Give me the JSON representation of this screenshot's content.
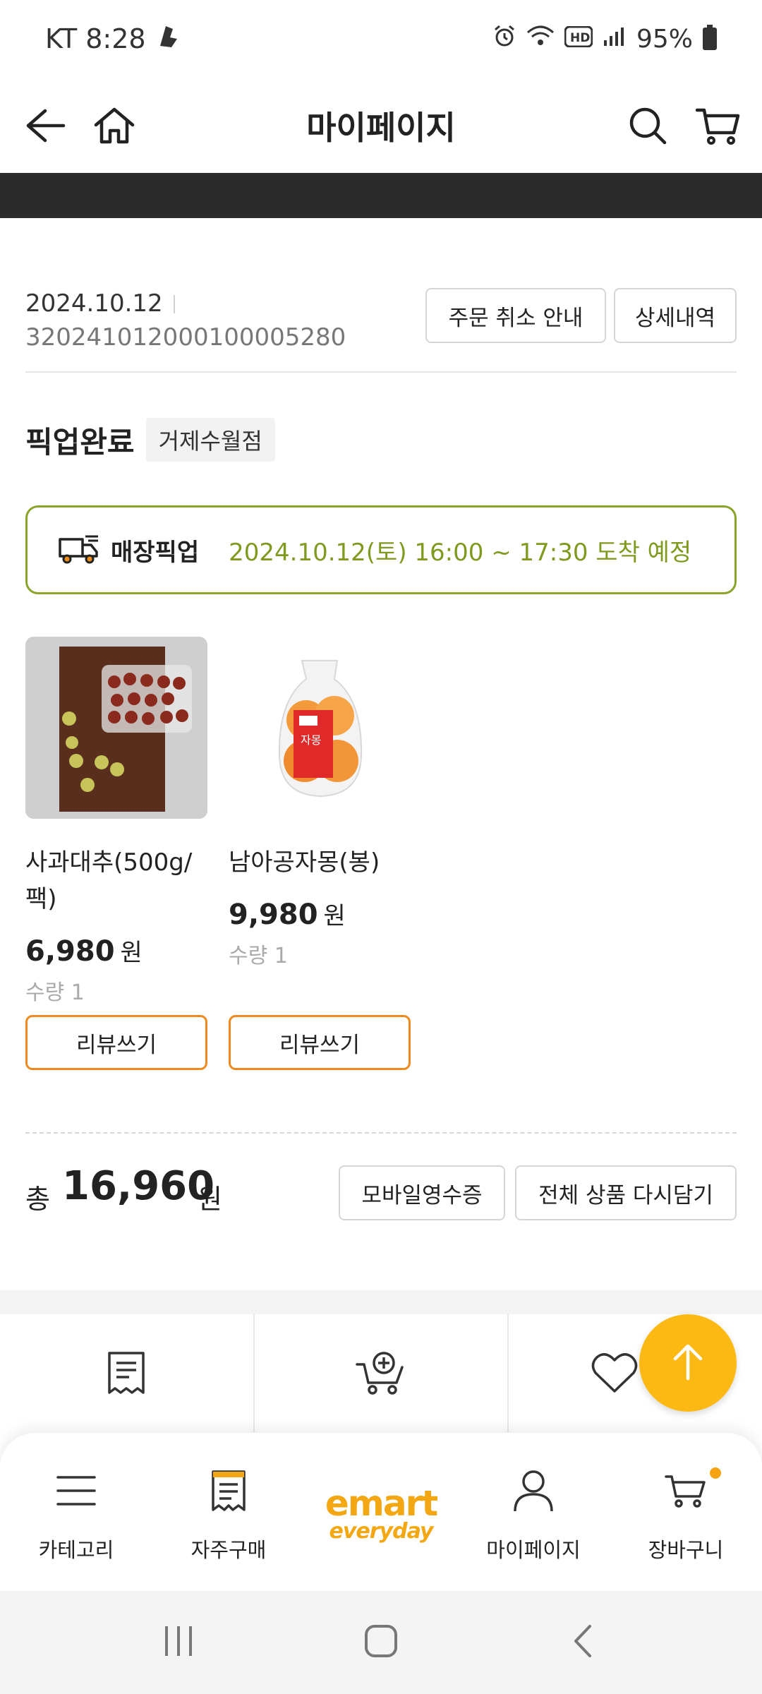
{
  "status_bar": {
    "carrier_time": "KT 8:28",
    "battery": "95%"
  },
  "header": {
    "title": "마이페이지"
  },
  "order": {
    "date": "2024.10.12",
    "number": "320241012000100005280",
    "cancel_guide_label": "주문 취소 안내",
    "detail_label": "상세내역"
  },
  "status": {
    "title": "픽업완료",
    "store": "거제수월점"
  },
  "pickup": {
    "label": "매장픽업",
    "time": "2024.10.12(토) 16:00 ~ 17:30 도착 예정"
  },
  "products": [
    {
      "name": "사과대추(500g/팩)",
      "price": "6,980",
      "won": "원",
      "qty": "수량 1",
      "review_label": "리뷰쓰기"
    },
    {
      "name": "남아공자몽(봉)",
      "price": "9,980",
      "won": "원",
      "qty": "수량 1",
      "review_label": "리뷰쓰기"
    }
  ],
  "total": {
    "label": "총",
    "amount": "16,960",
    "won": "원",
    "receipt_label": "모바일영수증",
    "readd_label": "전체 상품 다시담기"
  },
  "bottom_nav": [
    {
      "label": "카테고리",
      "icon": "menu-icon"
    },
    {
      "label": "자주구매",
      "icon": "receipt-icon"
    },
    {
      "label": "",
      "icon": "emart-everyday-logo"
    },
    {
      "label": "마이페이지",
      "icon": "person-icon"
    },
    {
      "label": "장바구니",
      "icon": "cart-icon"
    }
  ],
  "logo": {
    "top": "emart",
    "bottom": "everyday"
  },
  "colors": {
    "accent_orange": "#ef8a1e",
    "pickup_green": "#8aa329",
    "fab_yellow": "#fdb913"
  }
}
